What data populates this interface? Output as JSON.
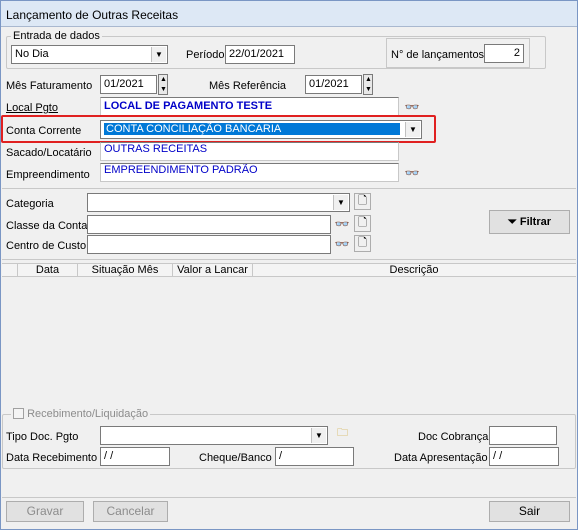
{
  "window": {
    "title": "Lançamento de Outras Receitas"
  },
  "entrada": {
    "legend": "Entrada de dados",
    "mode": "No Dia",
    "periodo_label": "Período",
    "periodo": "22/01/2021",
    "num_lanc_label": "N° de lançamentos",
    "num_lanc": "2"
  },
  "form": {
    "mes_fat_label": "Mês Faturamento",
    "mes_fat": "01/2021",
    "mes_ref_label": "Mês Referência",
    "mes_ref": "01/2021",
    "local_label": "Local Pgto",
    "local": "LOCAL DE PAGAMENTO TESTE",
    "conta_label": "Conta Corrente",
    "conta": "CONTA CONCILIAÇÃO BANCARIA",
    "sacado_label": "Sacado/Locatário",
    "sacado": "OUTRAS RECEITAS",
    "empreend_label": "Empreendimento",
    "empreend": "EMPREENDIMENTO PADRÃO"
  },
  "filters": {
    "categoria_label": "Categoria",
    "classe_label": "Classe da Conta",
    "centro_label": "Centro de Custo",
    "filtrar_label": "Filtrar"
  },
  "grid": {
    "columns": [
      "Data",
      "Situação Mês",
      "Valor a Lancar",
      "Descrição"
    ]
  },
  "receb": {
    "legend": "Recebimento/Liquidação",
    "tipo_doc_label": "Tipo Doc. Pgto",
    "doc_cobr_label": "Doc Cobrança",
    "data_receb_label": "Data Recebimento",
    "data_receb": " / /",
    "cheque_label": "Cheque/Banco",
    "cheque": " /",
    "data_apres_label": "Data Apresentação",
    "data_apres": " / /"
  },
  "buttons": {
    "gravar": "Gravar",
    "cancelar": "Cancelar",
    "sair": "Sair"
  },
  "colors": {
    "accent_select": "#0078d7",
    "highlight": "#e02020",
    "value_text": "#0000c8"
  }
}
